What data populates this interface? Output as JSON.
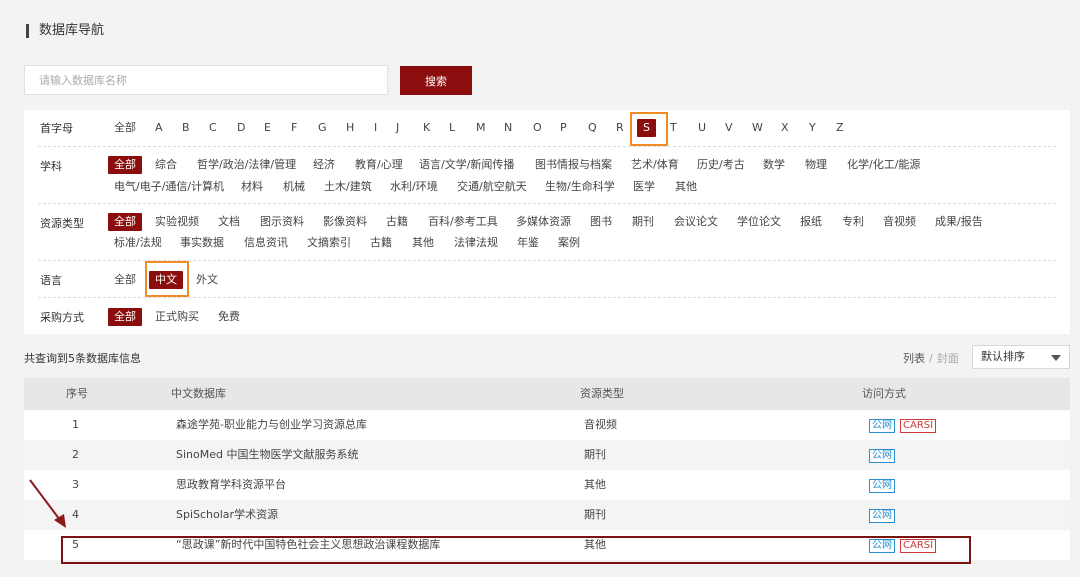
{
  "page_title": "数据库导航",
  "search": {
    "placeholder": "请输入数据库名称",
    "button_label": "搜索"
  },
  "filters": {
    "initial": {
      "label": "首字母",
      "items": [
        "全部",
        "A",
        "B",
        "C",
        "D",
        "E",
        "F",
        "G",
        "H",
        "I",
        "J",
        "K",
        "L",
        "M",
        "N",
        "O",
        "P",
        "Q",
        "R",
        "S",
        "T",
        "U",
        "V",
        "W",
        "X",
        "Y",
        "Z"
      ],
      "selected": "S"
    },
    "subject": {
      "label": "学科",
      "items": [
        "全部",
        "综合",
        "哲学/政治/法律/管理",
        "经济",
        "教育/心理",
        "语言/文学/新闻传播",
        "图书情报与档案",
        "艺术/体育",
        "历史/考古",
        "数学",
        "物理",
        "化学/化工/能源",
        "电气/电子/通信/计算机",
        "材料",
        "机械",
        "土木/建筑",
        "水利/环境",
        "交通/航空航天",
        "生物/生命科学",
        "医学",
        "其他"
      ],
      "selected": "全部"
    },
    "resource_type": {
      "label": "资源类型",
      "items": [
        "全部",
        "实验视频",
        "文档",
        "图示资料",
        "影像资料",
        "古籍",
        "百科/参考工具",
        "多媒体资源",
        "图书",
        "期刊",
        "会议论文",
        "学位论文",
        "报纸",
        "专利",
        "音视频",
        "成果/报告",
        "标准/法规",
        "事实数据",
        "信息资讯",
        "文摘索引",
        "古籍",
        "其他",
        "法律法规",
        "年鉴",
        "案例"
      ],
      "selected": "全部"
    },
    "language": {
      "label": "语言",
      "items": [
        "全部",
        "中文",
        "外文"
      ],
      "selected": "中文"
    },
    "purchase": {
      "label": "采购方式",
      "items": [
        "全部",
        "正式购买",
        "免费"
      ],
      "selected": "全部"
    }
  },
  "results": {
    "summary": "共查询到5条数据库信息",
    "view_list": "列表",
    "view_separator": "/",
    "view_cover": "封面",
    "sort_label": "默认排序"
  },
  "table": {
    "headers": [
      "序号",
      "中文数据库",
      "资源类型",
      "访问方式"
    ],
    "rows": [
      {
        "no": "1",
        "name": "森途学苑-职业能力与创业学习资源总库",
        "type": "音视频",
        "access": [
          "公网",
          "CARSI"
        ]
      },
      {
        "no": "2",
        "name": "SinoMed 中国生物医学文献服务系统",
        "type": "期刊",
        "access": [
          "公网"
        ]
      },
      {
        "no": "3",
        "name": "思政教育学科资源平台",
        "type": "其他",
        "access": [
          "公网"
        ]
      },
      {
        "no": "4",
        "name": "SpiScholar学术资源",
        "type": "期刊",
        "access": [
          "公网"
        ]
      },
      {
        "no": "5",
        "name": "“思政课”新时代中国特色社会主义思想政治课程数据库",
        "type": "其他",
        "access": [
          "公网",
          "CARSI"
        ]
      }
    ]
  },
  "colors": {
    "accent": "#8b0d0d",
    "highlight_orange": "#f08a24",
    "badge_public": "#2a8fd0",
    "badge_carsi": "#d23a3a"
  }
}
